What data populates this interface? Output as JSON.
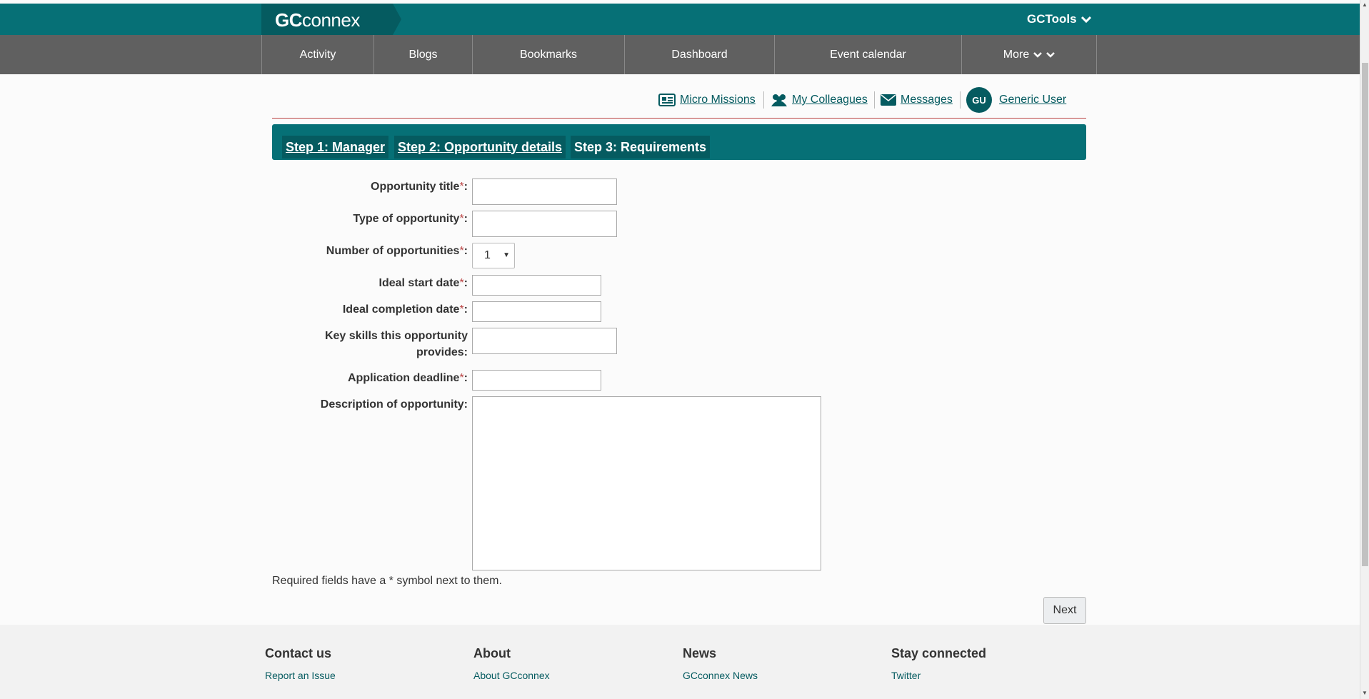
{
  "header": {
    "logo_bold": "GC",
    "logo_rest": "connex",
    "tools_label": "GCTools"
  },
  "nav": {
    "items": [
      {
        "label": "Activity"
      },
      {
        "label": "Blogs"
      },
      {
        "label": "Bookmarks"
      },
      {
        "label": "Dashboard"
      },
      {
        "label": "Event calendar"
      },
      {
        "label": "More"
      }
    ]
  },
  "userbar": {
    "micro_missions": "Micro Missions",
    "colleagues": "My Colleagues",
    "messages": "Messages",
    "avatar_initials": "GU",
    "user_name": "Generic User"
  },
  "steps": [
    {
      "label": "Step 1: Manager"
    },
    {
      "label": "Step 2: Opportunity details"
    },
    {
      "label": "Step 3: Requirements"
    }
  ],
  "form": {
    "required_mark": "*",
    "title_label": "Opportunity title",
    "type_label": "Type of opportunity",
    "number_label": "Number of opportunities",
    "number_value": "1",
    "start_label": "Ideal start date",
    "completion_label": "Ideal completion date",
    "skills_label": "Key skills this opportunity provides:",
    "deadline_label": "Application deadline",
    "description_label": "Description of opportunity:",
    "required_note": "Required fields have a * symbol next to them.",
    "next_label": "Next"
  },
  "footer": {
    "cols": [
      {
        "heading": "Contact us",
        "link": "Report an Issue"
      },
      {
        "heading": "About",
        "link": "About GCconnex"
      },
      {
        "heading": "News",
        "link": "GCconnex News"
      },
      {
        "heading": "Stay connected",
        "link": "Twitter"
      }
    ]
  },
  "colors": {
    "brand_teal": "#067076",
    "brand_dark_teal": "#055b60",
    "nav_gray": "#606060",
    "required_red": "#b44"
  },
  "icons": {
    "micro_missions": "newspaper-icon",
    "colleagues": "users-icon",
    "messages": "envelope-icon",
    "gctools": "chevron-down-icon"
  }
}
